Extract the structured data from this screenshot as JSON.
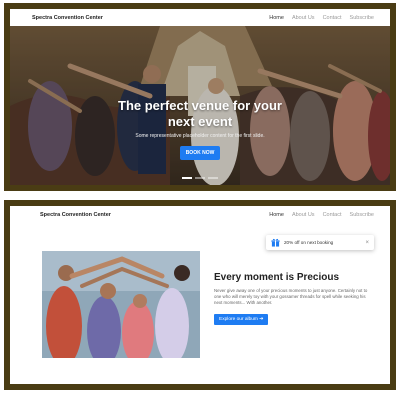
{
  "top": {
    "brand": "Spectra Convention Center",
    "nav": [
      "Home",
      "About Us",
      "Contact",
      "Subscribe"
    ],
    "hero": {
      "title_line1": "The perfect venue for your",
      "title_line2": "next event",
      "subtitle": "Some representative placeholder content for the first slide.",
      "button": "BOOK NOW"
    },
    "carousel": {
      "slides": 3,
      "active": 1
    }
  },
  "bottom": {
    "brand": "Spectra Convention Center",
    "nav": [
      "Home",
      "About Us",
      "Contact",
      "Subscribe"
    ],
    "toast": {
      "text": "20% off on next booking",
      "close": "×",
      "icon": "gift-icon"
    },
    "feature": {
      "title": "Every moment is Precious",
      "description": "Never give away one of your precious moments to just anyone. Certainly not to one who will merely toy with your gossamer threads for spell while seeking his next moments... With another.",
      "button": "Explore our album ➔"
    }
  },
  "colors": {
    "accent": "#1e7cf2",
    "frame": "#4a3c14"
  }
}
